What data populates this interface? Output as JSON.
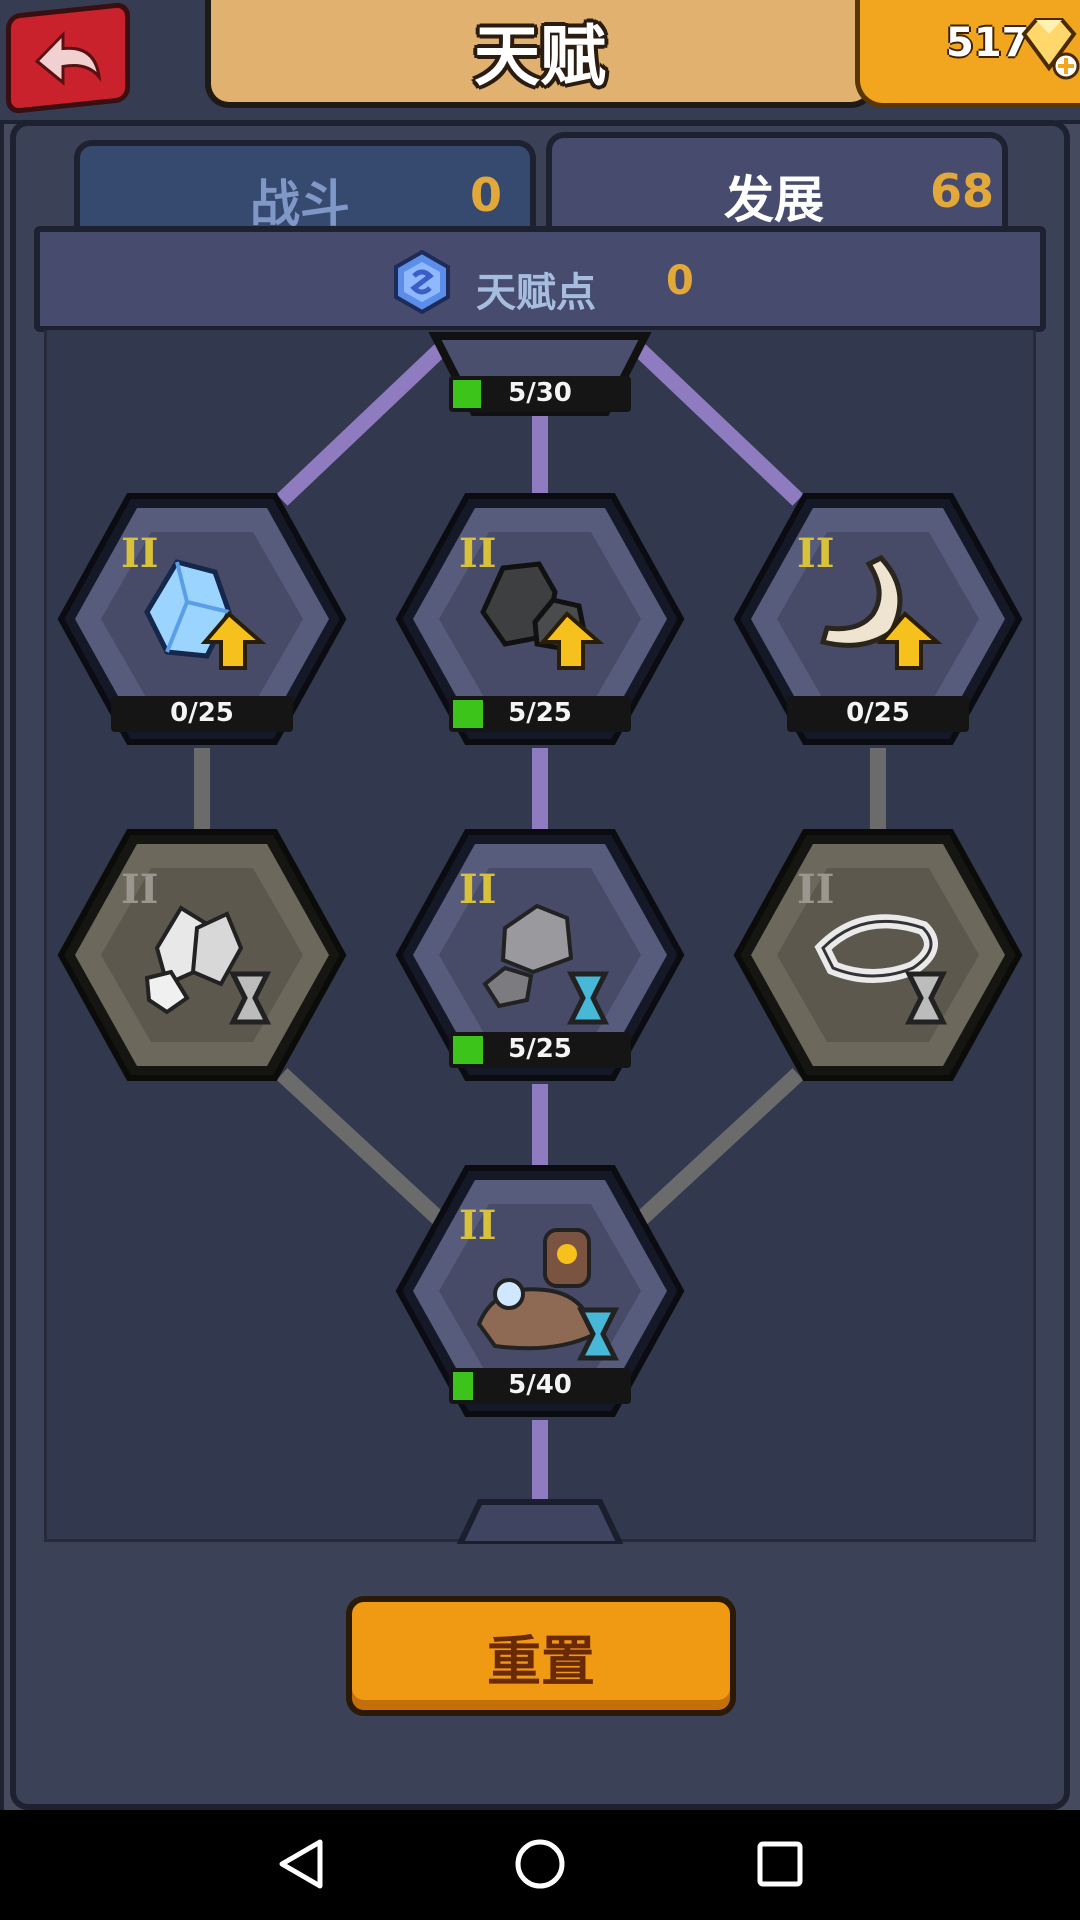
{
  "header": {
    "title": "天赋",
    "gems": "517"
  },
  "tabs": [
    {
      "label": "战斗",
      "value": "0",
      "active": false
    },
    {
      "label": "发展",
      "value": "68",
      "active": true
    }
  ],
  "talent_points": {
    "label": "天赋点",
    "value": "0",
    "icon": "talent-gem-icon"
  },
  "nodes": {
    "top": {
      "progress_text": "5/30",
      "progress": 0.167
    },
    "row1": [
      {
        "tier": "II",
        "icon": "crystal-upgrade-icon",
        "progress_text": "0/25",
        "progress": 0.0
      },
      {
        "tier": "II",
        "icon": "stone-upgrade-icon",
        "progress_text": "5/25",
        "progress": 0.2
      },
      {
        "tier": "II",
        "icon": "bone-upgrade-icon",
        "progress_text": "0/25",
        "progress": 0.0
      }
    ],
    "row2": [
      {
        "tier": "II",
        "icon": "crystal-time-icon",
        "locked": true
      },
      {
        "tier": "II",
        "icon": "stone-time-icon",
        "progress_text": "5/25",
        "progress": 0.2
      },
      {
        "tier": "II",
        "icon": "bone-time-icon",
        "locked": true
      }
    ],
    "row3": {
      "tier": "II",
      "icon": "workshop-time-icon",
      "progress_text": "5/40",
      "progress": 0.125
    }
  },
  "reset_button": "重置",
  "colors": {
    "active_line": "#8f7cc0",
    "locked_line": "#6b6b6b",
    "progress_fill": "#3cc41a",
    "tier_active": "#d8c23a"
  }
}
